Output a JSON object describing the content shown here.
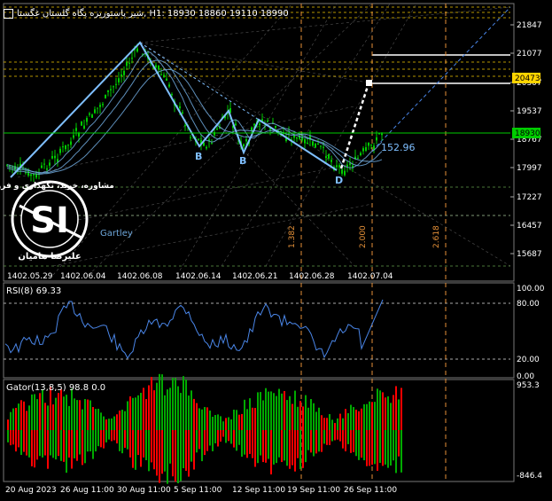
{
  "header": {
    "symbol_name": "شیر پاستوریزه پگاه گلستان",
    "symbol_short": "غگستا",
    "timeframe": "H1:",
    "ohlc": "18930 18860 19110 18990",
    "full_text": "شیر پاستوریزه پگاه گلستان غگستا, H1: 18930 18860 19110 18990"
  },
  "price_axis": {
    "ticks": [
      "21847",
      "21077",
      "20307",
      "19537",
      "18767",
      "17997",
      "17227",
      "16457",
      "15687"
    ],
    "current_price_label": "18930",
    "marker_label": "20473"
  },
  "main_chart": {
    "date_labels": [
      "1402.05.29",
      "1402.06.04",
      "1402.06.08",
      "1402.06.14",
      "1402.06.21",
      "1402.06.28",
      "1402.07.04"
    ],
    "fib_labels": [
      "1.382",
      "2.000",
      "2.618"
    ],
    "pattern_points": [
      "B",
      "B",
      "D"
    ],
    "pattern_value": "152.96",
    "pattern_name": "Gartley",
    "watermark": {
      "top_text": "مشاوره، خرید، نگهداری و فروش",
      "bottom_text": "علیرضا هامیان",
      "logo": "SI"
    }
  },
  "rsi_panel": {
    "title": "RSI(8) 69.33",
    "ticks": [
      "100.00",
      "80.00",
      "20.00",
      "0.00"
    ]
  },
  "gator_panel": {
    "title": "Gator(13,8,5) 98.8 0.0",
    "ticks": [
      "953.3",
      "-846.4"
    ]
  },
  "time_axis": {
    "labels": [
      "20 Aug 2023",
      "26 Aug 11:00",
      "30 Aug 11:00",
      "5 Sep 11:00",
      "12 Sep 11:00",
      "19 Sep 11:00",
      "26 Sep 11:00"
    ]
  },
  "colors": {
    "background": "#000000",
    "grid": "#ffffff",
    "candle_up": "#00cc00",
    "ma": "#6fa8dc",
    "rsi_line": "#4a86e8",
    "gator_up": "#00aa00",
    "gator_down": "#ff0000",
    "fib_line": "#e69138",
    "pattern": "#7fbfff"
  }
}
